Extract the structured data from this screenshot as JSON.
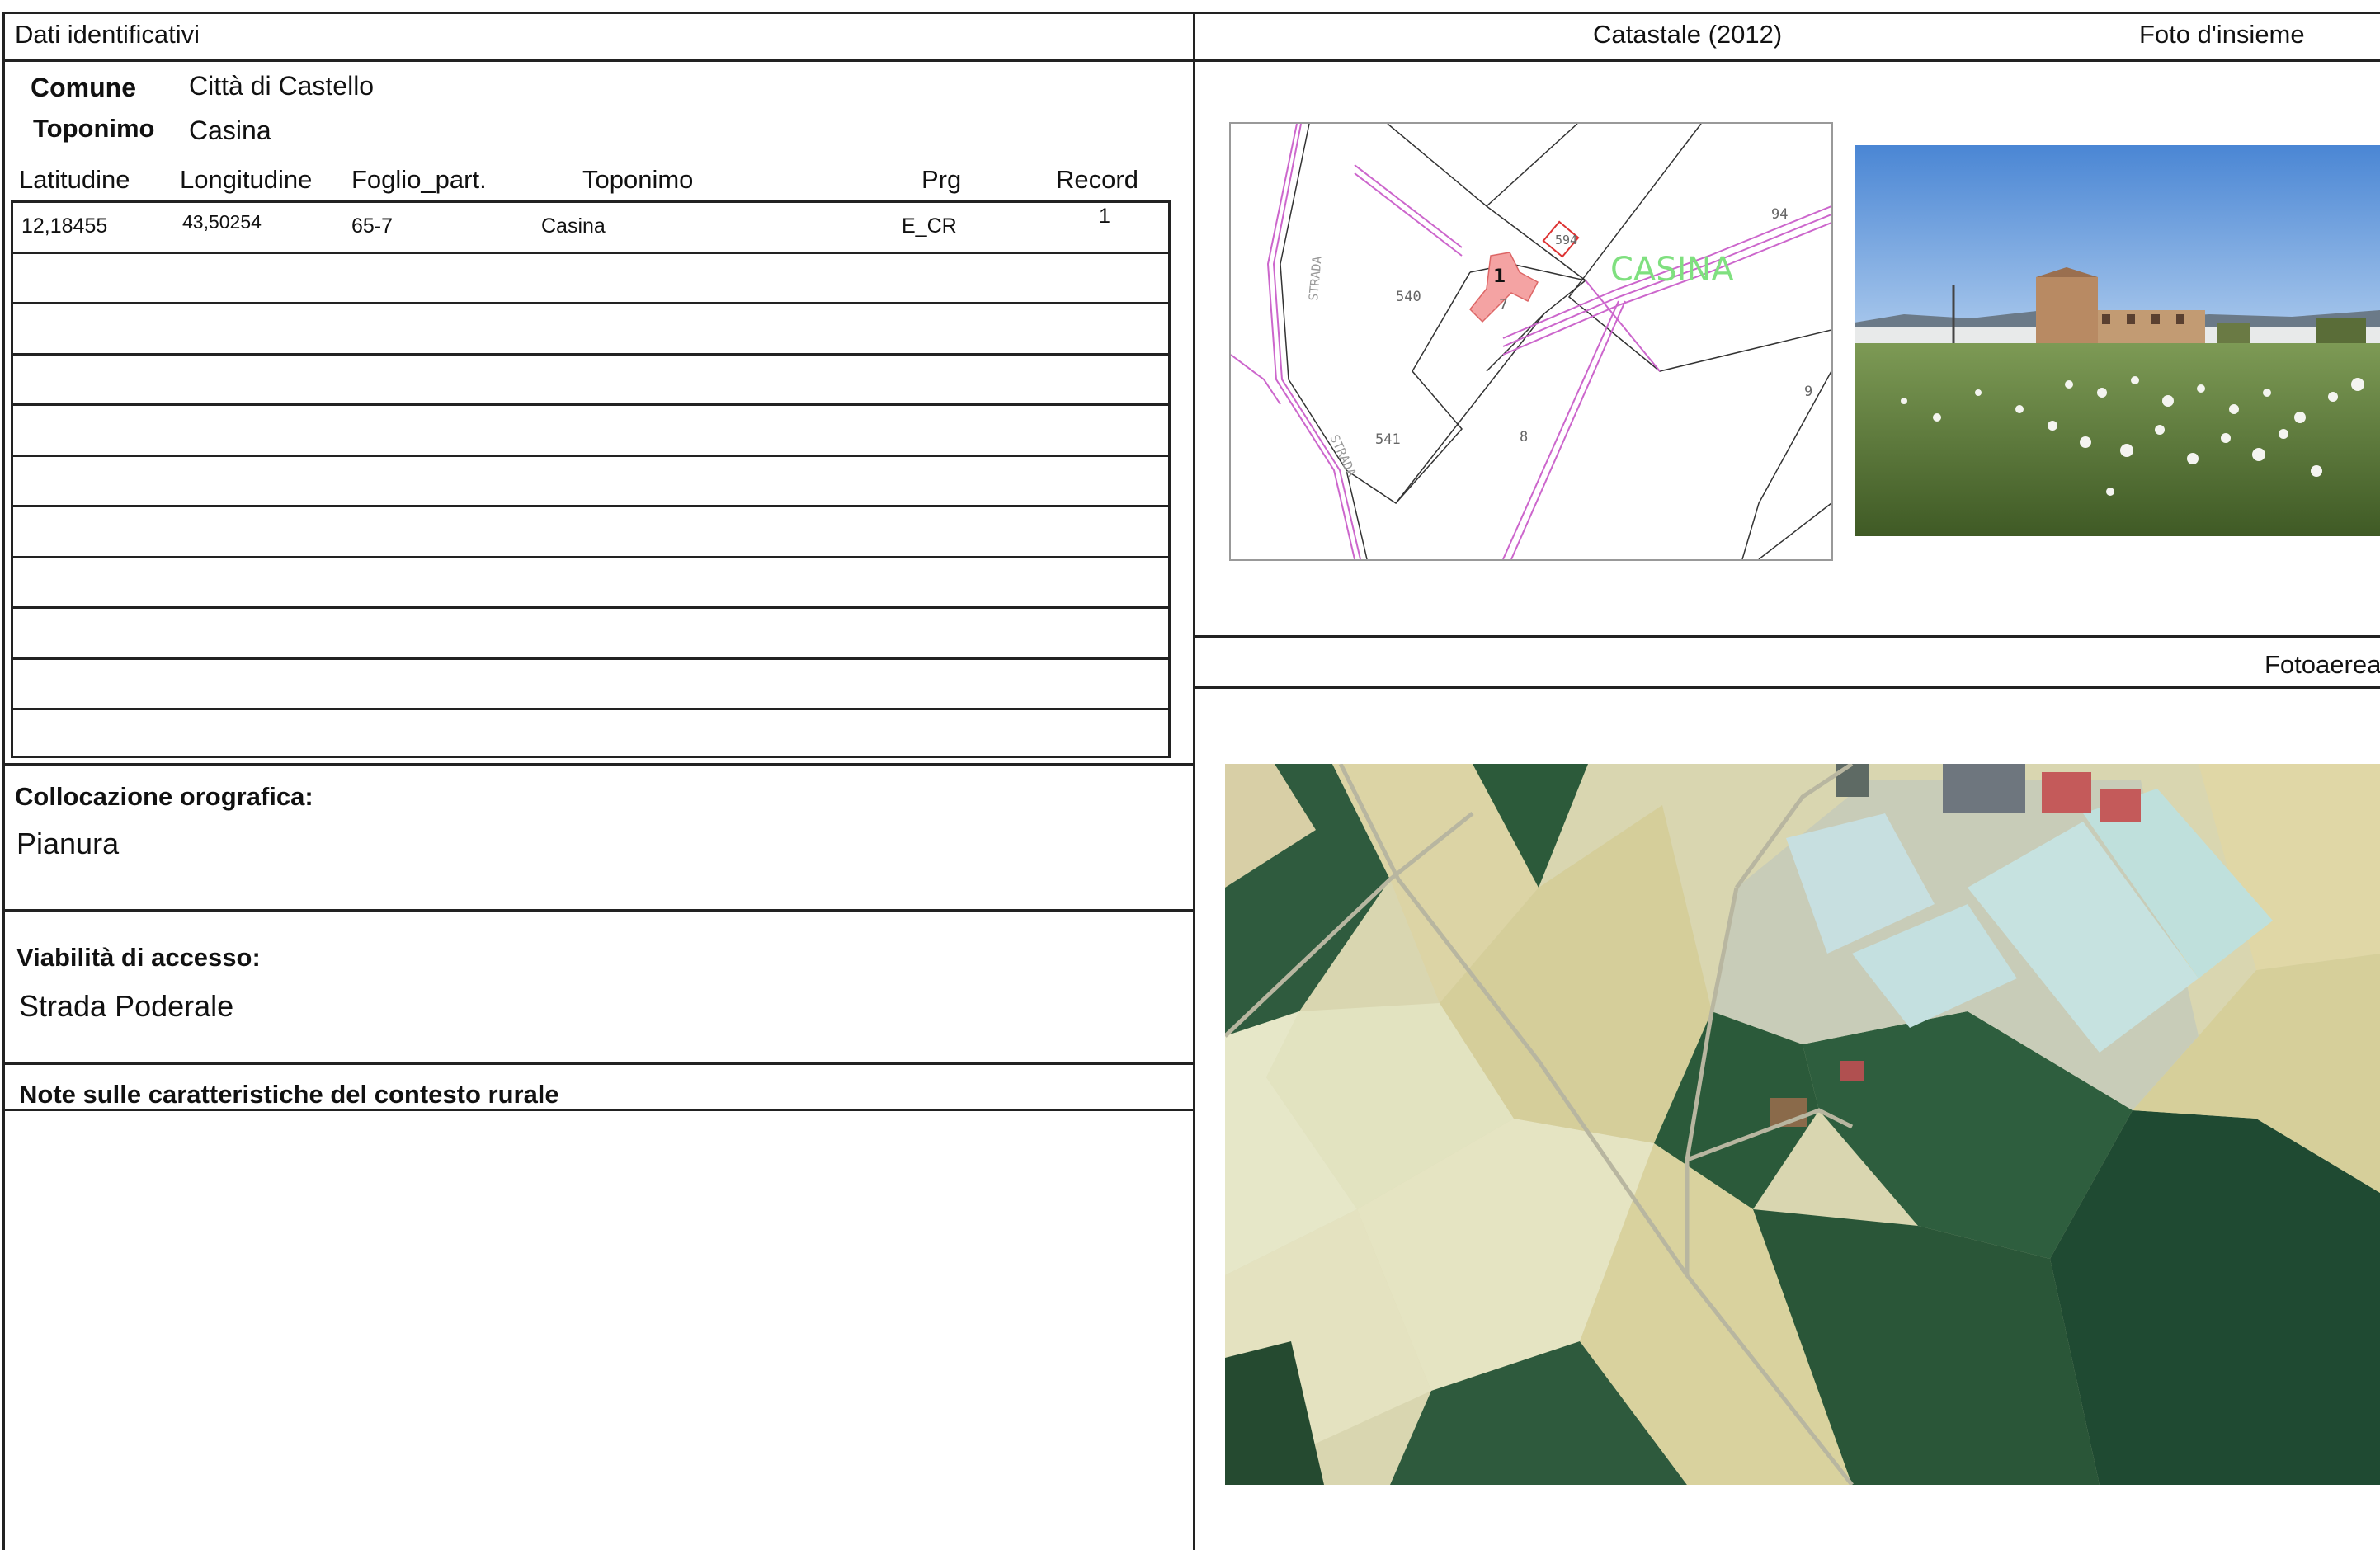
{
  "left_panel": {
    "section_title": "Dati identificativi",
    "comune_label": "Comune",
    "comune_value": "Città di Castello",
    "toponimo_label": "Toponimo",
    "toponimo_value": "Casina",
    "table": {
      "columns": [
        "Latitudine",
        "Longitudine",
        "Foglio_part.",
        "Toponimo",
        "Prg",
        "Record"
      ],
      "rows": [
        [
          "12,18455",
          "43,50254",
          "65-7",
          "Casina",
          "E_CR",
          "1"
        ]
      ]
    },
    "orografica_label": "Collocazione orografica:",
    "orografica_value": "Pianura",
    "viabilita_label": "Viabilità di accesso:",
    "viabilita_value": "Strada Poderale",
    "note_label": "Note sulle caratteristiche del contesto rurale"
  },
  "right_panel": {
    "catastale_title": "Catastale (2012)",
    "foto_title": "Foto d'insieme",
    "fotoaerea_title": "Fotoaerea",
    "map_labels": {
      "casina": "CASINA",
      "strada": "STRADA",
      "p540": "540",
      "p541": "541",
      "p594": "594",
      "p94": "94",
      "p9": "9",
      "p8": "8",
      "p7": "7",
      "p1": "1"
    }
  }
}
